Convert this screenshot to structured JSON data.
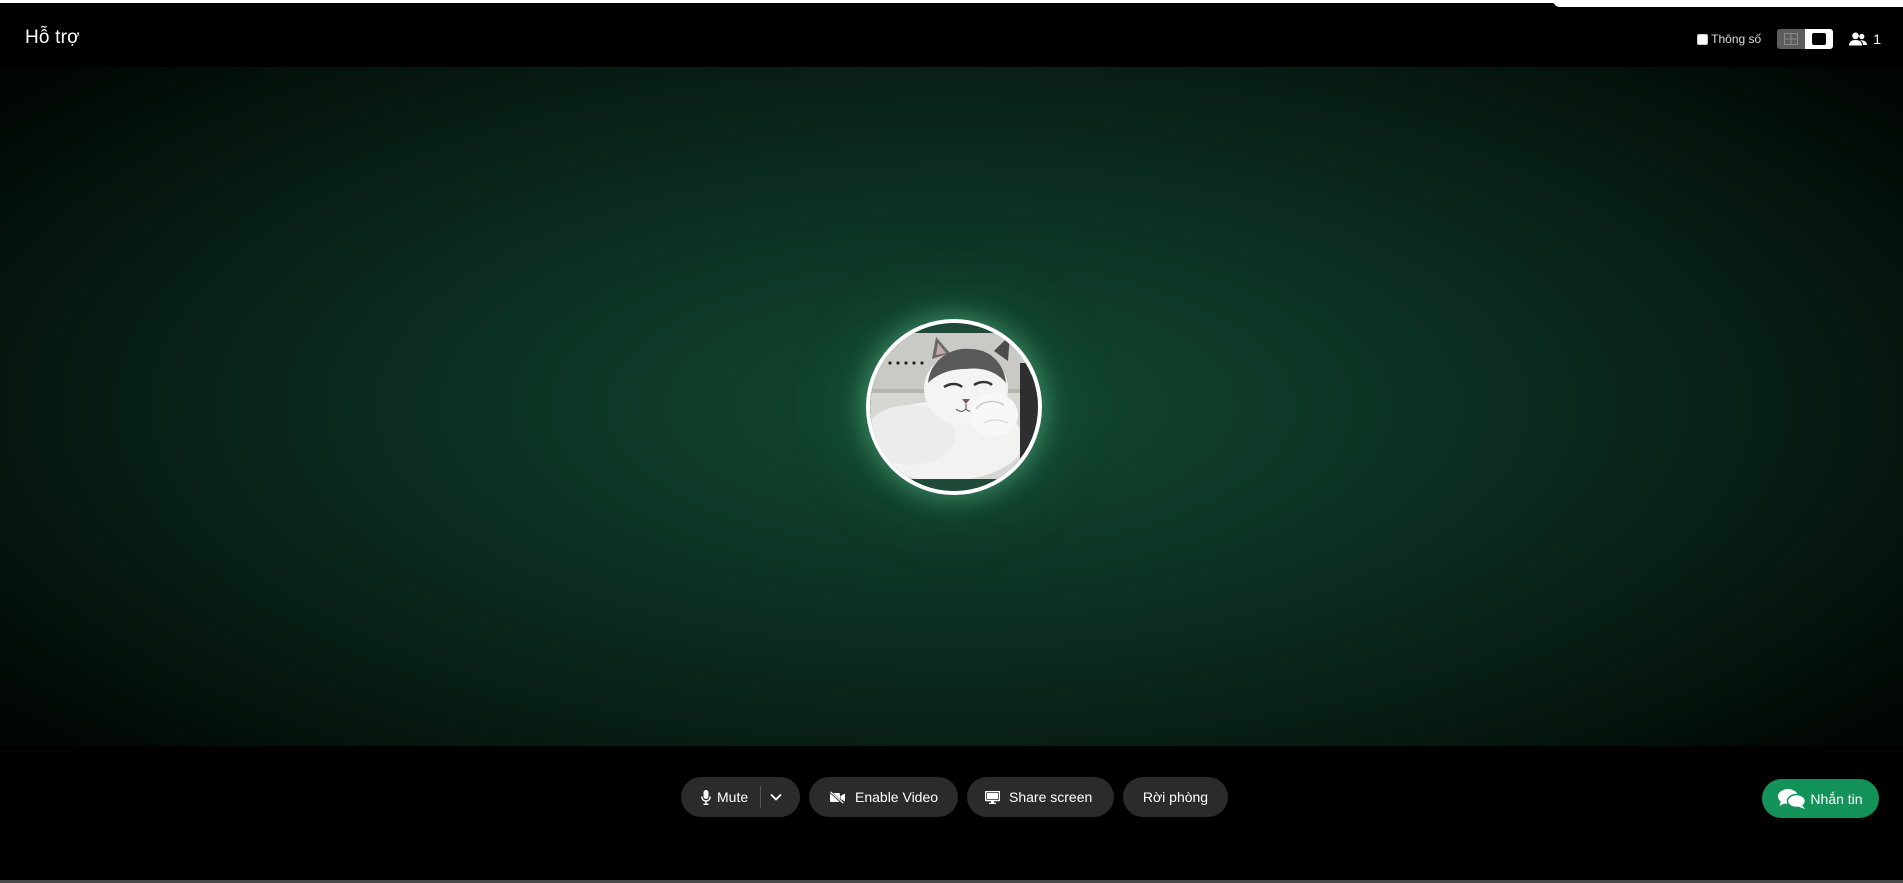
{
  "header": {
    "room_title": "Hỗ trợ",
    "stats_label": "Thông số",
    "stats_checked": false,
    "participant_count": "1"
  },
  "stage": {
    "avatar_alt": "Participant avatar"
  },
  "controls": {
    "mute_label": "Mute",
    "video_label": "Enable Video",
    "share_label": "Share screen",
    "leave_label": "Rời phòng"
  },
  "chat": {
    "button_label": "Nhắn tin"
  },
  "colors": {
    "stage_glow": "#124a33",
    "chat_button": "#13925a",
    "control_bg": "#2b2b2b"
  },
  "icons": [
    "microphone-icon",
    "chevron-down-icon",
    "video-off-icon",
    "monitor-icon",
    "users-icon",
    "chat-bubbles-icon",
    "grid-layout-icon",
    "speaker-layout-icon"
  ]
}
